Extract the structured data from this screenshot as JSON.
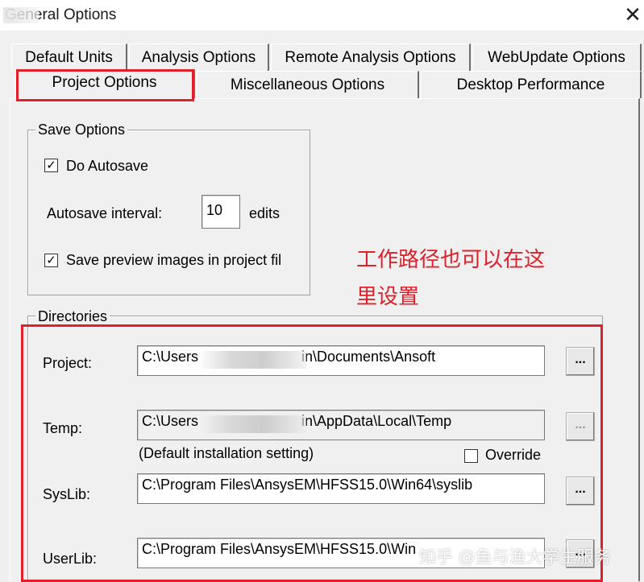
{
  "window": {
    "title": "General Options",
    "close_symbol": "✕"
  },
  "tabs": {
    "row1": [
      "Default Units",
      "Analysis Options",
      "Remote Analysis Options",
      "WebUpdate Options"
    ],
    "row2": [
      "Project Options",
      "Miscellaneous Options",
      "Desktop Performance"
    ],
    "active": "Project Options"
  },
  "save_options": {
    "legend": "Save Options",
    "autosave_label": "Do Autosave",
    "autosave_checked": true,
    "interval_label": "Autosave interval:",
    "interval_value": "10",
    "interval_unit": "edits",
    "preview_label": "Save preview images in project fil",
    "preview_checked": true
  },
  "directories": {
    "legend": "Directories",
    "project_label": "Project:",
    "project_prefix": "C:\\Users",
    "project_suffix": "in\\Documents\\Ansoft",
    "temp_label": "Temp:",
    "temp_prefix": "C:\\Users",
    "temp_suffix": "in\\AppData\\Local\\Temp",
    "temp_note": "(Default installation setting)",
    "override_label": "Override",
    "override_checked": false,
    "syslib_label": "SysLib:",
    "syslib_value": "C:\\Program Files\\AnsysEM\\HFSS15.0\\Win64\\syslib",
    "userlib_label": "UserLib:",
    "userlib_value": "C:\\Program Files\\AnsysEM\\HFSS15.0\\Win",
    "browse_label": "..."
  },
  "annotation": {
    "line1": "工作路径也可以在这",
    "line2": "里设置",
    "color": "#e0202a"
  },
  "watermark": "知乎 @鱼与渔大学生服务"
}
